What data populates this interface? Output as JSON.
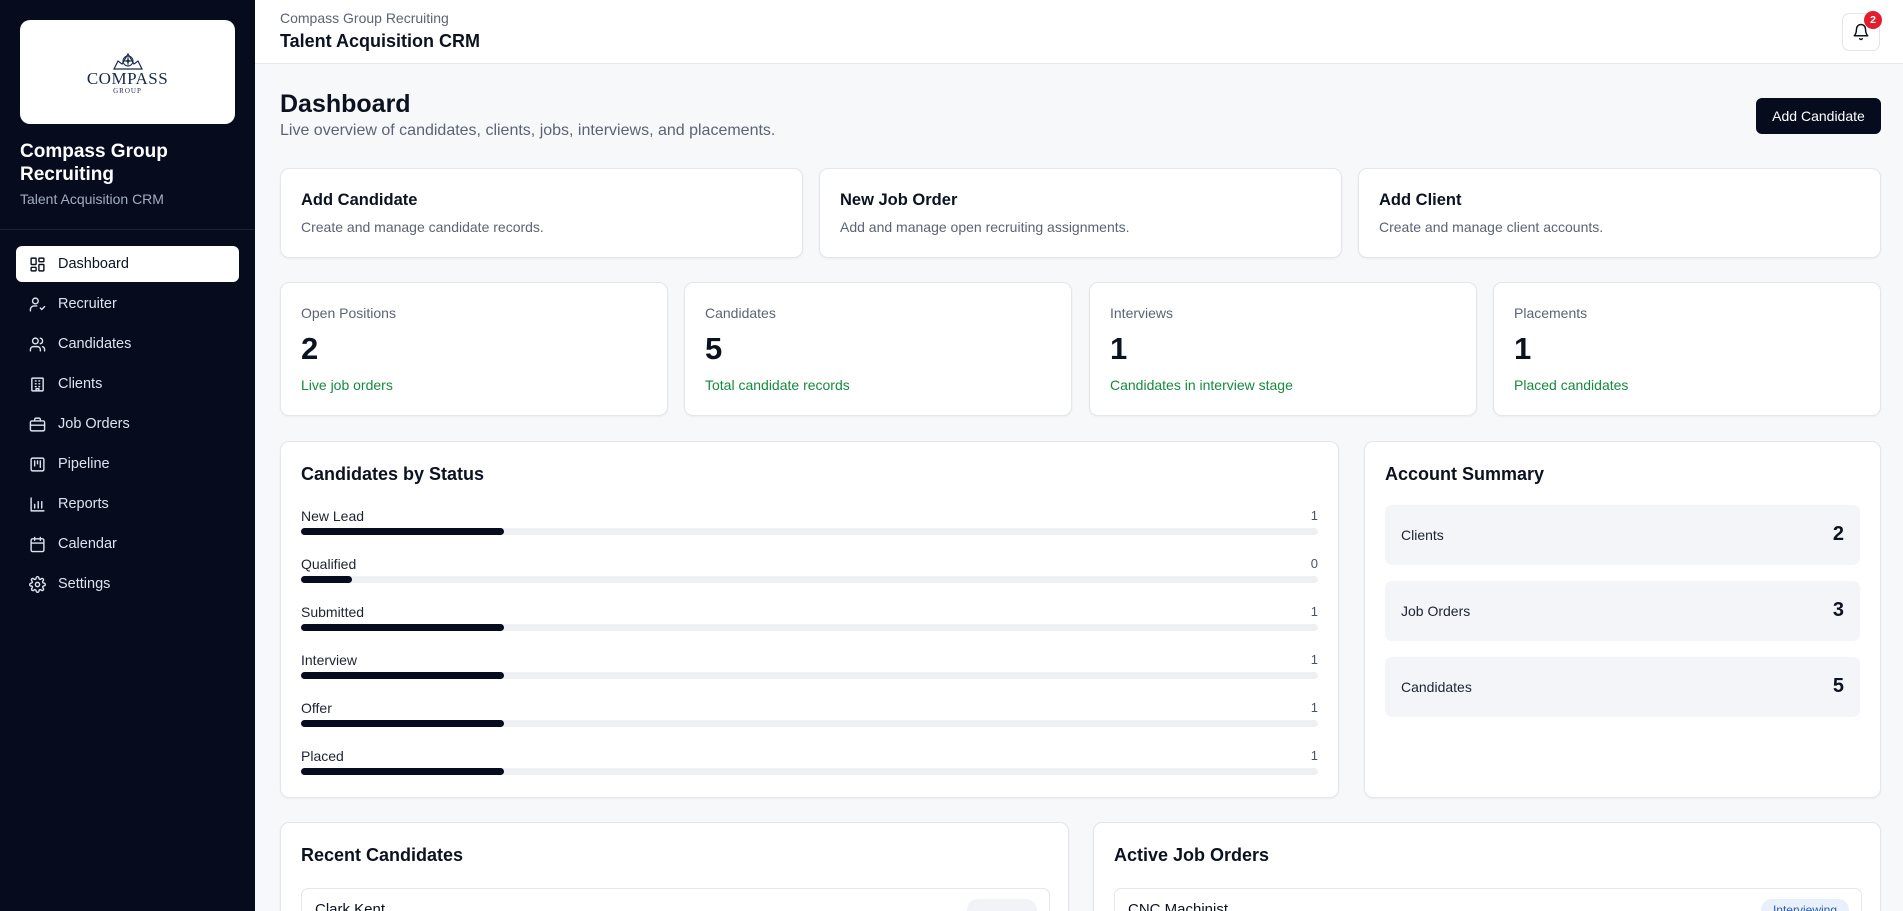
{
  "sidebar": {
    "logo": {
      "text": "COMPASS",
      "sub": "GROUP"
    },
    "brand_name": "Compass Group Recruiting",
    "brand_sub": "Talent Acquisition CRM",
    "items": [
      {
        "label": "Dashboard",
        "icon": "dashboard-icon",
        "active": true
      },
      {
        "label": "Recruiter",
        "icon": "user-check-icon"
      },
      {
        "label": "Candidates",
        "icon": "users-icon"
      },
      {
        "label": "Clients",
        "icon": "building-icon"
      },
      {
        "label": "Job Orders",
        "icon": "briefcase-icon"
      },
      {
        "label": "Pipeline",
        "icon": "kanban-icon"
      },
      {
        "label": "Reports",
        "icon": "bar-chart-icon"
      },
      {
        "label": "Calendar",
        "icon": "calendar-icon"
      },
      {
        "label": "Settings",
        "icon": "gear-icon"
      }
    ]
  },
  "topbar": {
    "org": "Compass Group Recruiting",
    "title": "Talent Acquisition CRM",
    "notifications": "2"
  },
  "header": {
    "title": "Dashboard",
    "subtitle": "Live overview of candidates, clients, jobs, interviews, and placements.",
    "add_button": "Add Candidate"
  },
  "quick_actions": [
    {
      "title": "Add Candidate",
      "desc": "Create and manage candidate records."
    },
    {
      "title": "New Job Order",
      "desc": "Add and manage open recruiting assignments."
    },
    {
      "title": "Add Client",
      "desc": "Create and manage client accounts."
    }
  ],
  "stats": [
    {
      "label": "Open Positions",
      "value": "2",
      "note": "Live job orders"
    },
    {
      "label": "Candidates",
      "value": "5",
      "note": "Total candidate records"
    },
    {
      "label": "Interviews",
      "value": "1",
      "note": "Candidates in interview stage"
    },
    {
      "label": "Placements",
      "value": "1",
      "note": "Placed candidates"
    }
  ],
  "status_panel": {
    "title": "Candidates by Status",
    "rows": [
      {
        "label": "New Lead",
        "count": "1",
        "fill_fraction": 0.2
      },
      {
        "label": "Qualified",
        "count": "0",
        "fill_fraction": 0.05
      },
      {
        "label": "Submitted",
        "count": "1",
        "fill_fraction": 0.2
      },
      {
        "label": "Interview",
        "count": "1",
        "fill_fraction": 0.2
      },
      {
        "label": "Offer",
        "count": "1",
        "fill_fraction": 0.2
      },
      {
        "label": "Placed",
        "count": "1",
        "fill_fraction": 0.2
      }
    ]
  },
  "account_summary": {
    "title": "Account Summary",
    "rows": [
      {
        "label": "Clients",
        "value": "2"
      },
      {
        "label": "Job Orders",
        "value": "3"
      },
      {
        "label": "Candidates",
        "value": "5"
      }
    ]
  },
  "recent_candidates": {
    "title": "Recent Candidates",
    "items": [
      {
        "name": "Clark Kent"
      }
    ]
  },
  "active_jobs": {
    "title": "Active Job Orders",
    "items": [
      {
        "name": "CNC Machinist",
        "status": "Interviewing"
      }
    ]
  },
  "colors": {
    "sidebar_bg": "#060b1d",
    "accent_green": "#168a3f",
    "badge_red": "#e11d2e",
    "pill_bg": "#e8f0fb",
    "pill_text": "#2a5db0"
  }
}
